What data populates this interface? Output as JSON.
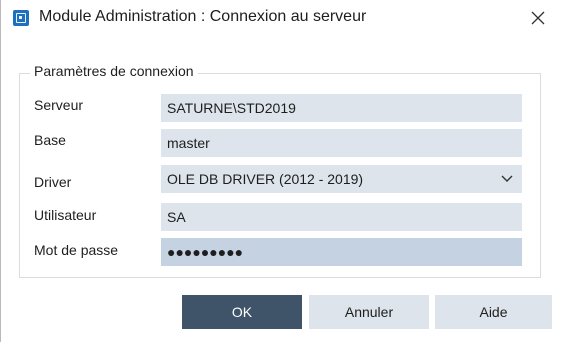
{
  "window": {
    "title": "Module Administration : Connexion au serveur",
    "icon": "app-module-icon",
    "close_icon": "close-icon"
  },
  "connection": {
    "group_title": "Paramètres de connexion",
    "fields": {
      "server": {
        "label": "Serveur",
        "value": "SATURNE\\STD2019"
      },
      "database": {
        "label": "Base",
        "value": "master"
      },
      "driver": {
        "label": "Driver",
        "value": "OLE DB DRIVER (2012 - 2019)"
      },
      "user": {
        "label": "Utilisateur",
        "value": "SA"
      },
      "password": {
        "label": "Mot de passe",
        "value": "●●●●●●●●●"
      }
    }
  },
  "buttons": {
    "ok": "OK",
    "cancel": "Annuler",
    "help": "Aide"
  },
  "colors": {
    "primary_button": "#3f5369",
    "field_background": "#dde4ec",
    "active_field_background": "#c4d2e1",
    "app_icon": "#1f6fbf"
  }
}
